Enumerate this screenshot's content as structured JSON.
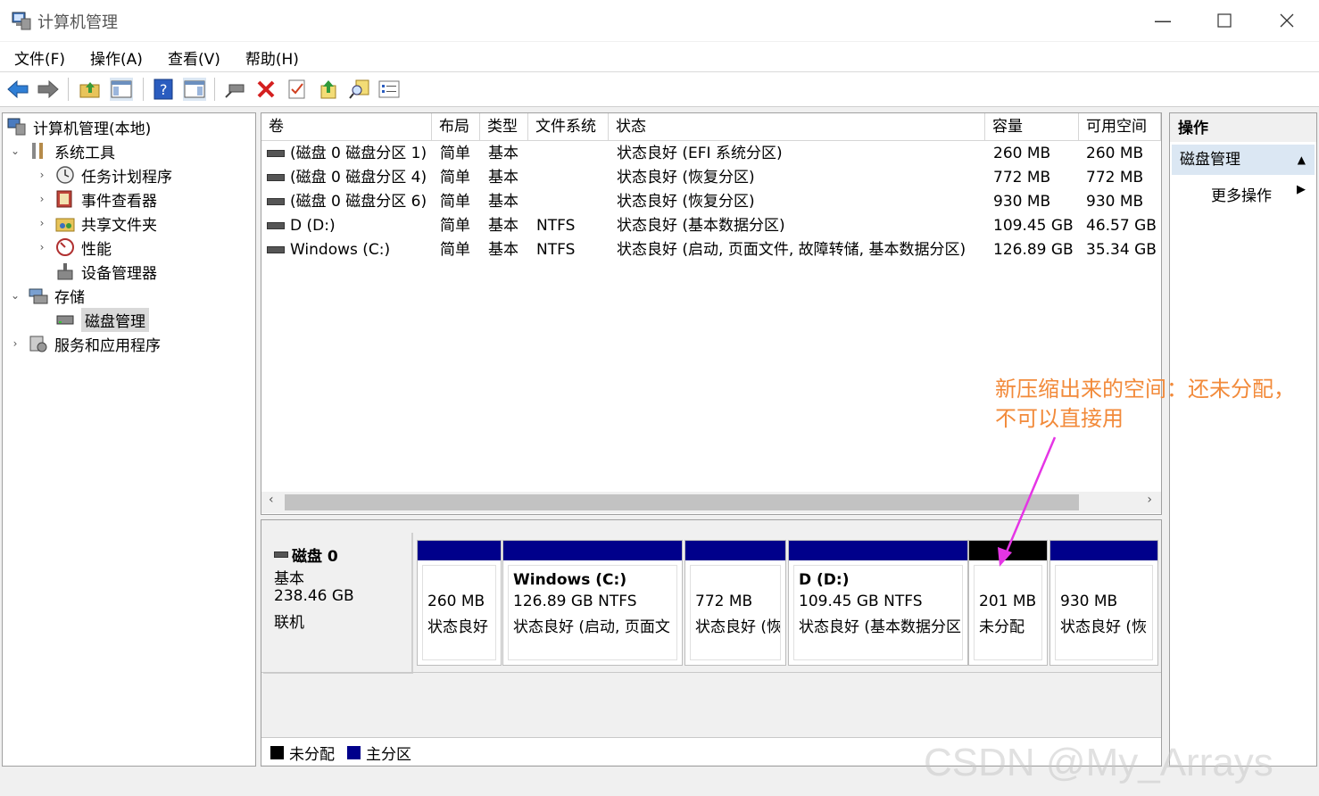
{
  "window": {
    "title": "计算机管理"
  },
  "menu": [
    "文件(F)",
    "操作(A)",
    "查看(V)",
    "帮助(H)"
  ],
  "tree": {
    "root": "计算机管理(本地)",
    "system_tools": "系统工具",
    "task_scheduler": "任务计划程序",
    "event_viewer": "事件查看器",
    "shared_folders": "共享文件夹",
    "performance": "性能",
    "device_manager": "设备管理器",
    "storage": "存储",
    "disk_management": "磁盘管理",
    "services_apps": "服务和应用程序"
  },
  "columns": [
    "卷",
    "布局",
    "类型",
    "文件系统",
    "状态",
    "容量",
    "可用空间"
  ],
  "volumes": [
    {
      "name": "(磁盘 0 磁盘分区 1)",
      "layout": "简单",
      "type": "基本",
      "fs": "",
      "status": "状态良好 (EFI 系统分区)",
      "capacity": "260 MB",
      "free": "260 MB"
    },
    {
      "name": "(磁盘 0 磁盘分区 4)",
      "layout": "简单",
      "type": "基本",
      "fs": "",
      "status": "状态良好 (恢复分区)",
      "capacity": "772 MB",
      "free": "772 MB"
    },
    {
      "name": "(磁盘 0 磁盘分区 6)",
      "layout": "简单",
      "type": "基本",
      "fs": "",
      "status": "状态良好 (恢复分区)",
      "capacity": "930 MB",
      "free": "930 MB"
    },
    {
      "name": "D (D:)",
      "layout": "简单",
      "type": "基本",
      "fs": "NTFS",
      "status": "状态良好 (基本数据分区)",
      "capacity": "109.45 GB",
      "free": "46.57 GB"
    },
    {
      "name": "Windows  (C:)",
      "layout": "简单",
      "type": "基本",
      "fs": "NTFS",
      "status": "状态良好 (启动, 页面文件, 故障转储, 基本数据分区)",
      "capacity": "126.89 GB",
      "free": "35.34 GB"
    }
  ],
  "disk": {
    "name": "磁盘 0",
    "type": "基本",
    "size": "238.46 GB",
    "state": "联机"
  },
  "partitions": [
    {
      "title": "",
      "line1": "260 MB",
      "line2": "状态良好",
      "color": "#00008b"
    },
    {
      "title": "Windows   (C:)",
      "line1": "126.89 GB NTFS",
      "line2": "状态良好 (启动, 页面文",
      "color": "#00008b"
    },
    {
      "title": "",
      "line1": "772 MB",
      "line2": "状态良好 (恢",
      "color": "#00008b"
    },
    {
      "title": "D  (D:)",
      "line1": "109.45 GB NTFS",
      "line2": "状态良好 (基本数据分区",
      "color": "#00008b"
    },
    {
      "title": "",
      "line1": "201 MB",
      "line2": "未分配",
      "color": "#000000"
    },
    {
      "title": "",
      "line1": "930 MB",
      "line2": "状态良好 (恢",
      "color": "#00008b"
    }
  ],
  "legend": {
    "unallocated": "未分配",
    "primary": "主分区"
  },
  "actions": {
    "header": "操作",
    "section": "磁盘管理",
    "more": "更多操作"
  },
  "annotation": {
    "line1": "新压缩出来的空间：还未分配，",
    "line2": "不可以直接用"
  },
  "watermark": "CSDN @My_Arrays",
  "colors": {
    "primary": "#00008b",
    "unallocated": "#000000",
    "annotation": "#f28a3a",
    "arrow": "#e535e5"
  }
}
